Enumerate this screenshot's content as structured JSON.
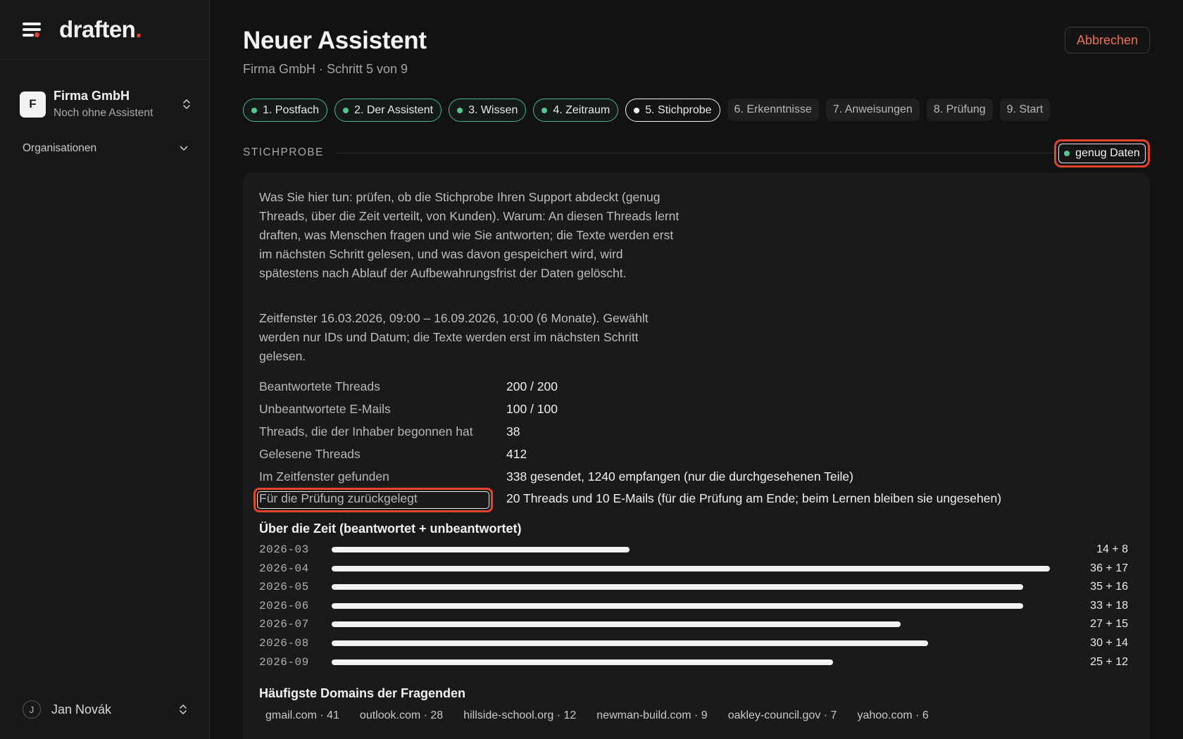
{
  "sidebar": {
    "logo": "draften",
    "logo_dot": ".",
    "org": {
      "initial": "F",
      "name": "Firma GmbH",
      "subtitle": "Noch ohne Assistent"
    },
    "nav_organisationen": "Organisationen",
    "user": {
      "initial": "J",
      "name": "Jan Novák"
    }
  },
  "header": {
    "title": "Neuer Assistent",
    "subtitle": "Firma GmbH · Schritt 5 von 9",
    "cancel_label": "Abbrechen"
  },
  "steps": [
    {
      "label": "1. Postfach",
      "state": "done"
    },
    {
      "label": "2. Der Assistent",
      "state": "done"
    },
    {
      "label": "3. Wissen",
      "state": "done"
    },
    {
      "label": "4. Zeitraum",
      "state": "done"
    },
    {
      "label": "5. Stichprobe",
      "state": "active"
    },
    {
      "label": "6. Erkenntnisse",
      "state": "todo"
    },
    {
      "label": "7. Anweisungen",
      "state": "todo"
    },
    {
      "label": "8. Prüfung",
      "state": "todo"
    },
    {
      "label": "9. Start",
      "state": "todo"
    }
  ],
  "section": {
    "label": "STICHPROBE",
    "status_badge": "genug Daten"
  },
  "card": {
    "intro": "Was Sie hier tun: prüfen, ob die Stichprobe Ihren Support abdeckt (genug Threads, über die Zeit verteilt, von Kunden). Warum: An diesen Threads lernt draften, was Menschen fragen und wie Sie antworten; die Texte werden erst im nächsten Schritt gelesen, und was davon gespeichert wird, wird spätestens nach Ablauf der Aufbewahrungsfrist der Daten gelöscht.",
    "window": "Zeitfenster 16.03.2026, 09:00 – 16.09.2026, 10:00 (6 Monate). Gewählt werden nur IDs und Datum; die Texte werden erst im nächsten Schritt gelesen.",
    "stats": [
      {
        "label": "Beantwortete Threads",
        "value": "200 / 200"
      },
      {
        "label": "Unbeantwortete E-Mails",
        "value": "100 / 100"
      },
      {
        "label": "Threads, die der Inhaber begonnen hat",
        "value": "38"
      },
      {
        "label": "Gelesene Threads",
        "value": "412"
      },
      {
        "label": "Im Zeitfenster gefunden",
        "value": "338 gesendet, 1240 empfangen (nur die durchgesehenen Teile)"
      },
      {
        "label": "Für die Prüfung zurückgelegt",
        "value": "20 Threads und 10 E-Mails (für die Prüfung am Ende; beim Lernen bleiben sie ungesehen)"
      }
    ],
    "chart_title": "Über die Zeit (beantwortet + unbeantwortet)",
    "domains_title": "Häufigste Domains der Fragenden",
    "domains": [
      "gmail.com · 41",
      "outlook.com · 28",
      "hillside-school.org · 12",
      "newman-build.com · 9",
      "oakley-council.gov · 7",
      "yahoo.com · 6"
    ]
  },
  "chart_data": {
    "type": "bar",
    "orientation": "horizontal",
    "title": "Über die Zeit (beantwortet + unbeantwortet)",
    "categories": [
      "2026-03",
      "2026-04",
      "2026-05",
      "2026-06",
      "2026-07",
      "2026-08",
      "2026-09"
    ],
    "series": [
      {
        "name": "beantwortet",
        "values": [
          14,
          36,
          35,
          33,
          27,
          30,
          25
        ]
      },
      {
        "name": "unbeantwortet",
        "values": [
          8,
          17,
          16,
          18,
          15,
          14,
          12
        ]
      }
    ],
    "value_labels": [
      "14 + 8",
      "36 + 17",
      "35 + 16",
      "33 + 18",
      "27 + 15",
      "30 + 14",
      "25 + 12"
    ],
    "max_total": 53
  },
  "colors": {
    "accent_green": "#55c694",
    "accent_red": "#e0432f",
    "background": "#121212"
  }
}
